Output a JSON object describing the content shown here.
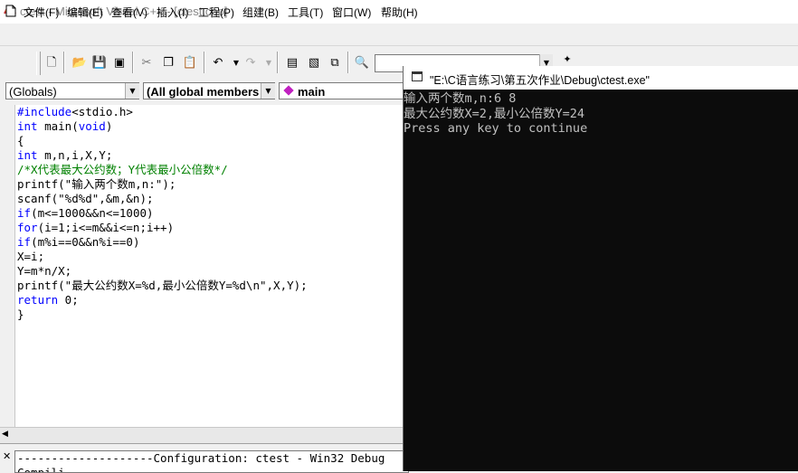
{
  "window": {
    "title": "ctest - Microsoft Visual C++ - [ctest.cpp]"
  },
  "menu": {
    "items": [
      "文件(F)",
      "编辑(E)",
      "查看(V)",
      "插入(I)",
      "工程(P)",
      "组建(B)",
      "工具(T)",
      "窗口(W)",
      "帮助(H)"
    ]
  },
  "toolbar": {
    "icons": [
      "new-file-icon",
      "open-folder-icon",
      "save-icon",
      "save-all-icon",
      "cut-icon",
      "copy-icon",
      "paste-icon",
      "undo-icon",
      "redo-icon",
      "workspace-icon",
      "output-window-icon",
      "windows-list-icon",
      "find-in-files-icon"
    ]
  },
  "wizard": {
    "class_combo": "(Globals)",
    "members_combo": "(All global members",
    "function_combo": "main"
  },
  "code": {
    "lines": [
      {
        "parts": [
          {
            "t": "#include",
            "c": "kw"
          },
          {
            "t": "<stdio.h>"
          }
        ]
      },
      {
        "parts": [
          {
            "t": "int",
            "c": "kw"
          },
          {
            "t": " main("
          },
          {
            "t": "void",
            "c": "kw"
          },
          {
            "t": ")"
          }
        ]
      },
      {
        "parts": [
          {
            "t": "{"
          }
        ]
      },
      {
        "parts": [
          {
            "t": "int",
            "c": "kw"
          },
          {
            "t": " m,n,i,X,Y;"
          }
        ]
      },
      {
        "parts": [
          {
            "t": "/*X代表最大公约数；Y代表最小公倍数*/",
            "c": "cm"
          }
        ]
      },
      {
        "parts": [
          {
            "t": "printf(\"输入两个数m,n:\");"
          }
        ]
      },
      {
        "parts": [
          {
            "t": "scanf(\"%d%d\",&m,&n);"
          }
        ]
      },
      {
        "parts": [
          {
            "t": "if",
            "c": "kw"
          },
          {
            "t": "(m<=1000&&n<=1000)"
          }
        ]
      },
      {
        "parts": [
          {
            "t": "for",
            "c": "kw"
          },
          {
            "t": "(i=1;i<=m&&i<=n;i++)"
          }
        ]
      },
      {
        "parts": [
          {
            "t": "if",
            "c": "kw"
          },
          {
            "t": "(m%i==0&&n%i==0)"
          }
        ]
      },
      {
        "parts": [
          {
            "t": "X=i;"
          }
        ]
      },
      {
        "parts": [
          {
            "t": "Y=m*n/X;"
          }
        ]
      },
      {
        "parts": [
          {
            "t": "printf(\"最大公约数X=%d,最小公倍数Y=%d\\n\",X,Y);"
          }
        ]
      },
      {
        "parts": [
          {
            "t": "return",
            "c": "kw"
          },
          {
            "t": " 0;"
          }
        ]
      },
      {
        "parts": [
          {
            "t": "}"
          }
        ]
      }
    ]
  },
  "output": {
    "line1": "--------------------Configuration: ctest - Win32 Debug",
    "line2": "Compili"
  },
  "console": {
    "title": "\"E:\\C语言练习\\第五次作业\\Debug\\ctest.exe\"",
    "lines": [
      "输入两个数m,n:6 8",
      "最大公约数X=2,最小公倍数Y=24",
      "Press any key to continue"
    ]
  }
}
